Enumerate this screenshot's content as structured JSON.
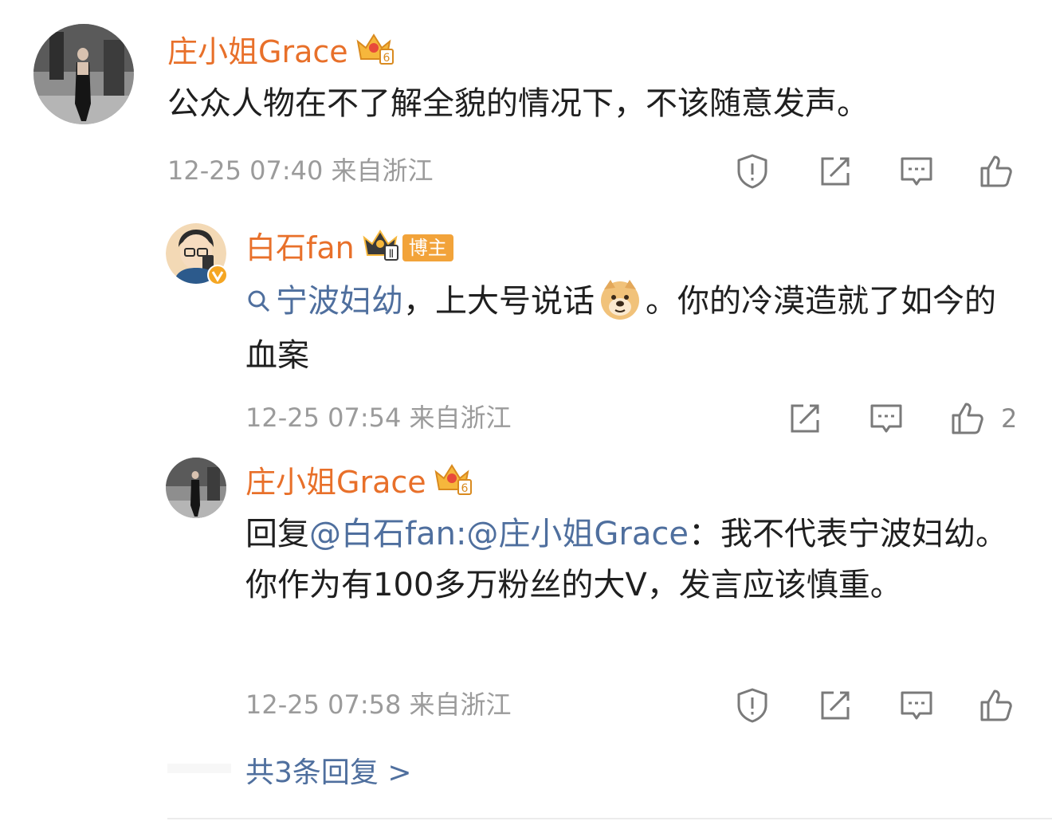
{
  "comment": {
    "author": "庄小姐Grace",
    "text": "公众人物在不了解全貌的情况下，不该随意发声。",
    "time": "12-25 07:40",
    "location": "来自浙江"
  },
  "replies": [
    {
      "author": "白石fan",
      "badge": "博主",
      "search_link": "宁波妇幼",
      "text_before": "，上大号说话",
      "text_after": "。你的冷漠造就了如今的血案",
      "time": "12-25 07:54",
      "location": "来自浙江",
      "likes": "2"
    },
    {
      "author": "庄小姐Grace",
      "reply_prefix": "回复",
      "mention": "@白石fan:@庄小姐Grace",
      "text": "：我不代表宁波妇幼。你作为有100多万粉丝的大V，发言应该慎重。",
      "time": "12-25 07:58",
      "location": "来自浙江"
    }
  ],
  "more_replies": "共3条回复 >",
  "colors": {
    "name": "#e8702a",
    "link": "#4f6f9e",
    "meta": "#9b9b9b",
    "badge": "#f2a33a"
  }
}
